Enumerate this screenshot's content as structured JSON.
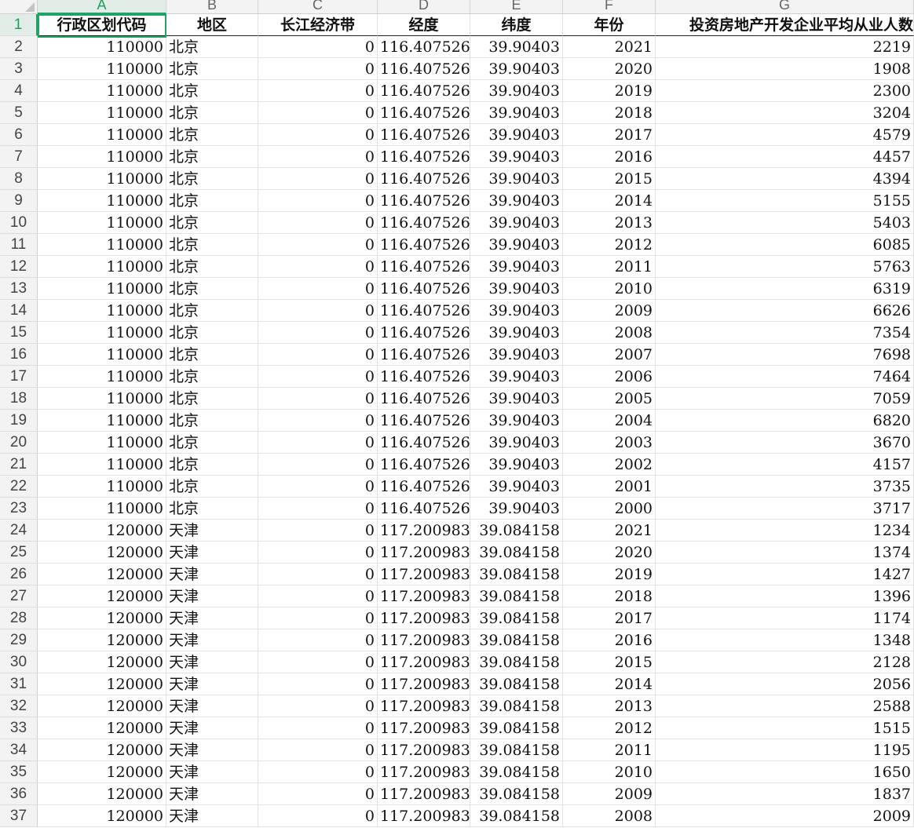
{
  "columns": [
    {
      "letter": "A",
      "header": "行政区划代码"
    },
    {
      "letter": "B",
      "header": "地区"
    },
    {
      "letter": "C",
      "header": "长江经济带"
    },
    {
      "letter": "D",
      "header": "经度"
    },
    {
      "letter": "E",
      "header": "纬度"
    },
    {
      "letter": "F",
      "header": "年份"
    },
    {
      "letter": "G",
      "header": "投资房地产开发企业平均从业人数"
    }
  ],
  "rows": [
    [
      "110000",
      "北京",
      "0",
      "116.407526",
      "39.90403",
      "2021",
      "2219"
    ],
    [
      "110000",
      "北京",
      "0",
      "116.407526",
      "39.90403",
      "2020",
      "1908"
    ],
    [
      "110000",
      "北京",
      "0",
      "116.407526",
      "39.90403",
      "2019",
      "2300"
    ],
    [
      "110000",
      "北京",
      "0",
      "116.407526",
      "39.90403",
      "2018",
      "3204"
    ],
    [
      "110000",
      "北京",
      "0",
      "116.407526",
      "39.90403",
      "2017",
      "4579"
    ],
    [
      "110000",
      "北京",
      "0",
      "116.407526",
      "39.90403",
      "2016",
      "4457"
    ],
    [
      "110000",
      "北京",
      "0",
      "116.407526",
      "39.90403",
      "2015",
      "4394"
    ],
    [
      "110000",
      "北京",
      "0",
      "116.407526",
      "39.90403",
      "2014",
      "5155"
    ],
    [
      "110000",
      "北京",
      "0",
      "116.407526",
      "39.90403",
      "2013",
      "5403"
    ],
    [
      "110000",
      "北京",
      "0",
      "116.407526",
      "39.90403",
      "2012",
      "6085"
    ],
    [
      "110000",
      "北京",
      "0",
      "116.407526",
      "39.90403",
      "2011",
      "5763"
    ],
    [
      "110000",
      "北京",
      "0",
      "116.407526",
      "39.90403",
      "2010",
      "6319"
    ],
    [
      "110000",
      "北京",
      "0",
      "116.407526",
      "39.90403",
      "2009",
      "6626"
    ],
    [
      "110000",
      "北京",
      "0",
      "116.407526",
      "39.90403",
      "2008",
      "7354"
    ],
    [
      "110000",
      "北京",
      "0",
      "116.407526",
      "39.90403",
      "2007",
      "7698"
    ],
    [
      "110000",
      "北京",
      "0",
      "116.407526",
      "39.90403",
      "2006",
      "7464"
    ],
    [
      "110000",
      "北京",
      "0",
      "116.407526",
      "39.90403",
      "2005",
      "7059"
    ],
    [
      "110000",
      "北京",
      "0",
      "116.407526",
      "39.90403",
      "2004",
      "6820"
    ],
    [
      "110000",
      "北京",
      "0",
      "116.407526",
      "39.90403",
      "2003",
      "3670"
    ],
    [
      "110000",
      "北京",
      "0",
      "116.407526",
      "39.90403",
      "2002",
      "4157"
    ],
    [
      "110000",
      "北京",
      "0",
      "116.407526",
      "39.90403",
      "2001",
      "3735"
    ],
    [
      "110000",
      "北京",
      "0",
      "116.407526",
      "39.90403",
      "2000",
      "3717"
    ],
    [
      "120000",
      "天津",
      "0",
      "117.200983",
      "39.084158",
      "2021",
      "1234"
    ],
    [
      "120000",
      "天津",
      "0",
      "117.200983",
      "39.084158",
      "2020",
      "1374"
    ],
    [
      "120000",
      "天津",
      "0",
      "117.200983",
      "39.084158",
      "2019",
      "1427"
    ],
    [
      "120000",
      "天津",
      "0",
      "117.200983",
      "39.084158",
      "2018",
      "1396"
    ],
    [
      "120000",
      "天津",
      "0",
      "117.200983",
      "39.084158",
      "2017",
      "1174"
    ],
    [
      "120000",
      "天津",
      "0",
      "117.200983",
      "39.084158",
      "2016",
      "1348"
    ],
    [
      "120000",
      "天津",
      "0",
      "117.200983",
      "39.084158",
      "2015",
      "2128"
    ],
    [
      "120000",
      "天津",
      "0",
      "117.200983",
      "39.084158",
      "2014",
      "2056"
    ],
    [
      "120000",
      "天津",
      "0",
      "117.200983",
      "39.084158",
      "2013",
      "2588"
    ],
    [
      "120000",
      "天津",
      "0",
      "117.200983",
      "39.084158",
      "2012",
      "1515"
    ],
    [
      "120000",
      "天津",
      "0",
      "117.200983",
      "39.084158",
      "2011",
      "1195"
    ],
    [
      "120000",
      "天津",
      "0",
      "117.200983",
      "39.084158",
      "2010",
      "1650"
    ],
    [
      "120000",
      "天津",
      "0",
      "117.200983",
      "39.084158",
      "2009",
      "1837"
    ],
    [
      "120000",
      "天津",
      "0",
      "117.200983",
      "39.084158",
      "2008",
      "2009"
    ]
  ],
  "selection": {
    "active_column": "A",
    "active_row": "1"
  },
  "colors": {
    "accent": "#21a366",
    "header_bg": "#f3f3f3"
  }
}
